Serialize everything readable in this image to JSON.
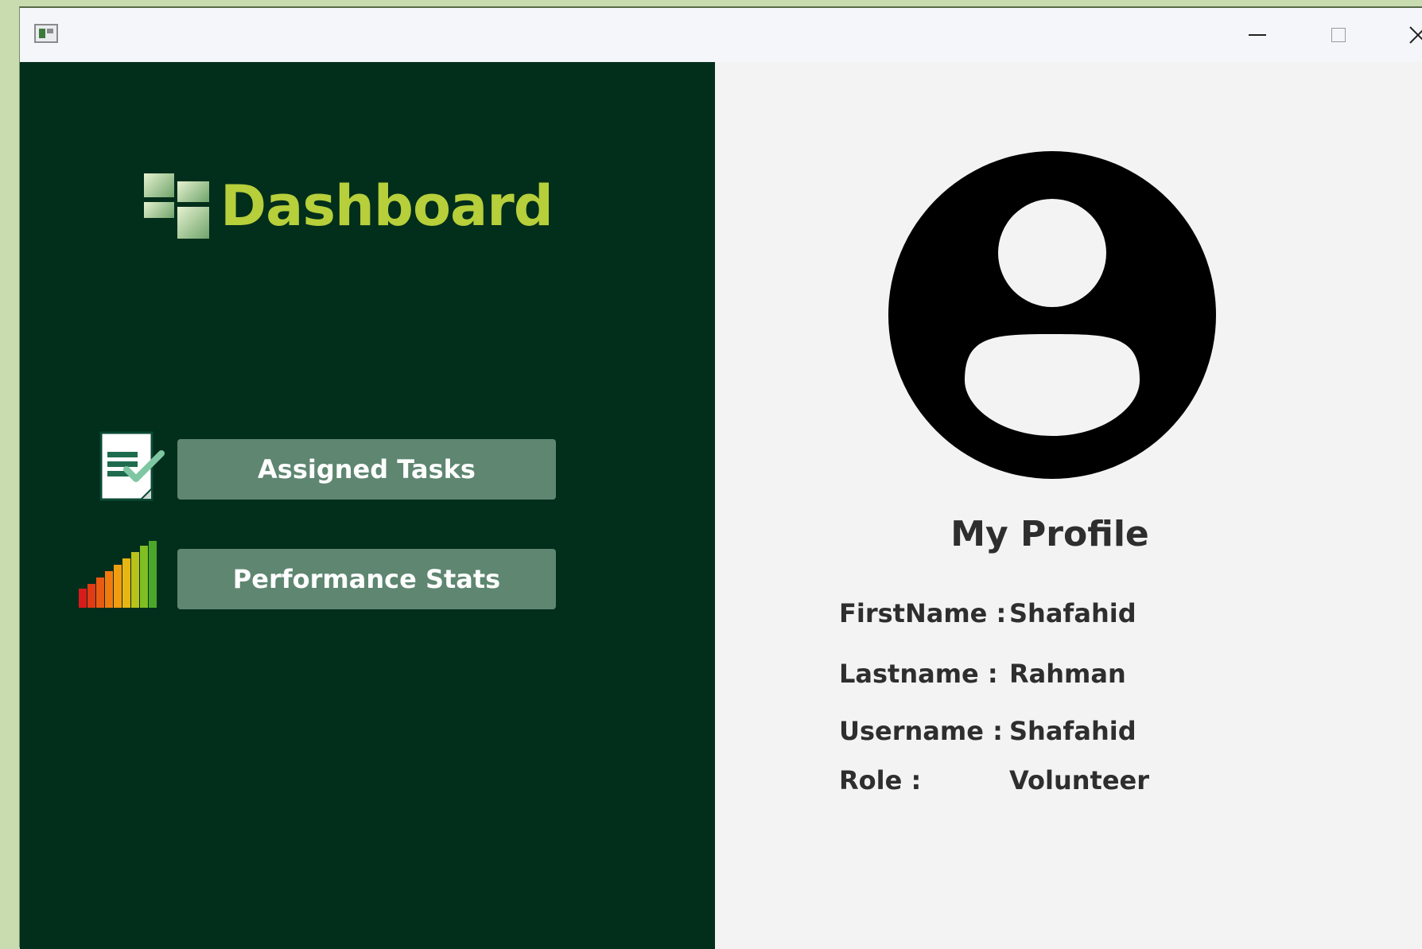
{
  "window": {
    "controls": {
      "minimize_icon": "minimize-icon",
      "maximize_icon": "maximize-icon",
      "close_icon": "close-icon"
    }
  },
  "sidebar": {
    "title": "Dashboard",
    "title_color": "#b6cf3a",
    "background_color": "#022e1c",
    "items": [
      {
        "label": "Assigned Tasks",
        "icon": "task-document-icon"
      },
      {
        "label": "Performance Stats",
        "icon": "bar-stats-icon"
      }
    ],
    "button_color": "#5e8670"
  },
  "profile": {
    "title": "My Profile",
    "avatar_icon": "user-avatar-icon",
    "fields": [
      {
        "label": "FirstName :",
        "value": "Shafahid"
      },
      {
        "label": "Lastname :",
        "value": "Rahman"
      },
      {
        "label": "Username  :",
        "value": "Shafahid"
      },
      {
        "label": "Role :",
        "value": "Volunteer"
      }
    ]
  }
}
